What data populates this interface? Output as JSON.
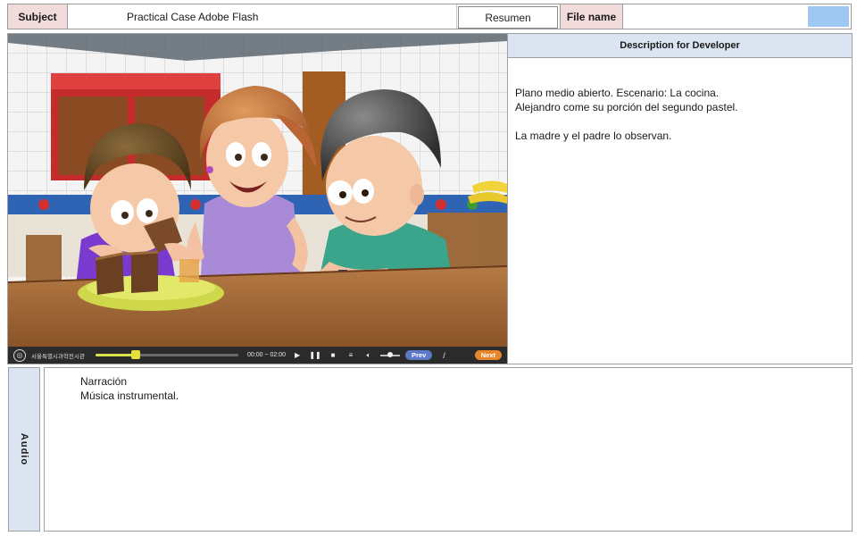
{
  "header": {
    "subject_label": "Subject",
    "subject_value": "Practical Case Adobe Flash",
    "resumen_label": "Resumen",
    "filename_label": "File name",
    "filename_value": "",
    "filename_swatch_color": "#9ec8f2"
  },
  "player": {
    "org_name": "서울특별시과학전시관",
    "time": "00:00 ~ 02:00",
    "progress": 0.28,
    "volume": 0.5,
    "prev_label": "Prev",
    "separator": "/",
    "next_label": "Next",
    "icons": [
      "logo-icon",
      "play-icon",
      "pause-icon",
      "stop-icon",
      "menu-icon",
      "volume-icon"
    ]
  },
  "description": {
    "header": "Description for Developer",
    "line1": "Plano medio abierto. Escenario: La cocina.",
    "line2": "Alejandro come su porción del segundo pastel.",
    "line3": "La madre y el padre lo observan."
  },
  "audio": {
    "label": "Audio",
    "line1": "Narración",
    "line2": "Música instrumental."
  },
  "colors": {
    "label_pink": "#f2dcdb",
    "header_blue": "#dbe5f1",
    "prev_blue": "#5b79c7",
    "next_orange": "#e8862b"
  }
}
